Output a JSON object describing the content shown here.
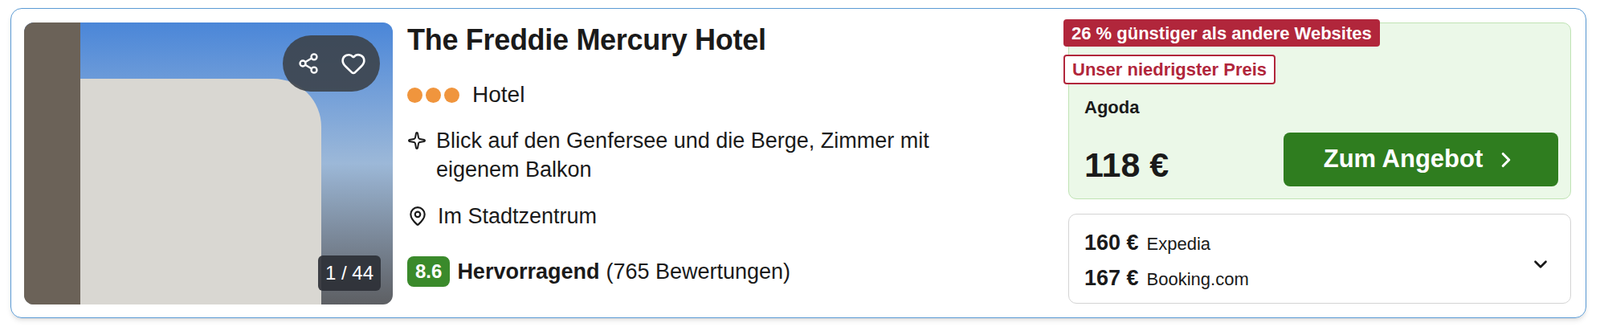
{
  "hotel": {
    "name": "The Freddie Mercury Hotel",
    "stars": 3,
    "type": "Hotel",
    "highlight": "Blick auf den Genfersee und die Berge, Zimmer mit eigenem Balkon",
    "location": "Im Stadtzentrum",
    "rating": {
      "score": "8.6",
      "label": "Hervorragend",
      "count": "(765 Bewertungen)"
    },
    "photo": {
      "counter": "1 / 44",
      "favorite": false
    }
  },
  "deal": {
    "badges": [
      {
        "label": "26 % günstiger als andere Websites",
        "kind": "filled"
      },
      {
        "label": "Unser niedrigster Preis",
        "kind": "outline"
      }
    ],
    "provider": "Agoda",
    "price": "118 €",
    "button": "Zum Angebot"
  },
  "offers": [
    {
      "price": "160 €",
      "provider": "Expedia"
    },
    {
      "price": "167 €",
      "provider": "Booking.com"
    }
  ],
  "offers_expanded": false
}
